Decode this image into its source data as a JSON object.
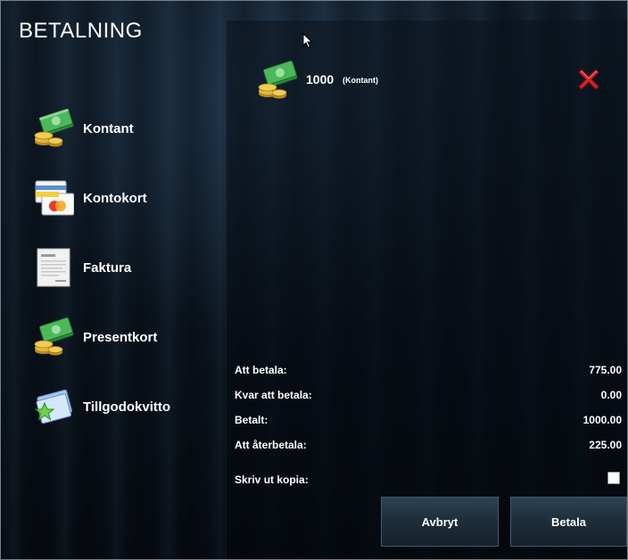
{
  "page": {
    "title": "BETALNING"
  },
  "payment_methods": [
    {
      "label": "Kontant",
      "icon": "cash-icon"
    },
    {
      "label": "Kontokort",
      "icon": "credit-card-icon"
    },
    {
      "label": "Faktura",
      "icon": "invoice-icon"
    },
    {
      "label": "Presentkort",
      "icon": "gift-card-icon"
    },
    {
      "label": "Tillgodokvitto",
      "icon": "credit-note-icon"
    }
  ],
  "payments": [
    {
      "amount": "1000",
      "method": "(Kontant)",
      "icon": "cash-icon"
    }
  ],
  "summary": {
    "to_pay_label": "Att betala:",
    "to_pay_value": "775.00",
    "remaining_label": "Kvar att betala:",
    "remaining_value": "0.00",
    "paid_label": "Betalt:",
    "paid_value": "1000.00",
    "change_label": "Att återbetala:",
    "change_value": "225.00",
    "print_copy_label": "Skriv ut kopia:"
  },
  "buttons": {
    "cancel": "Avbryt",
    "pay": "Betala"
  },
  "colors": {
    "remove_red": "#d2232a",
    "cash_green": "#3aa64a",
    "coin_gold": "#d6a92e"
  }
}
